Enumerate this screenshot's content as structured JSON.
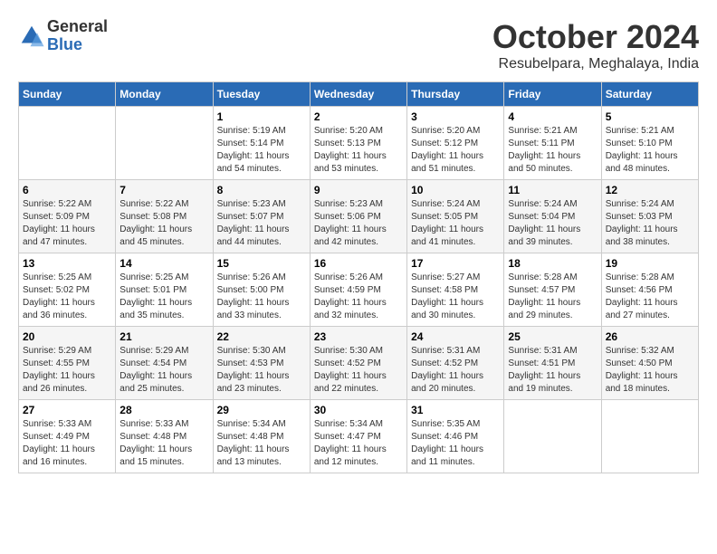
{
  "logo": {
    "general": "General",
    "blue": "Blue"
  },
  "title": "October 2024",
  "location": "Resubelpara, Meghalaya, India",
  "days_header": [
    "Sunday",
    "Monday",
    "Tuesday",
    "Wednesday",
    "Thursday",
    "Friday",
    "Saturday"
  ],
  "weeks": [
    [
      {
        "day": "",
        "info": ""
      },
      {
        "day": "",
        "info": ""
      },
      {
        "day": "1",
        "info": "Sunrise: 5:19 AM\nSunset: 5:14 PM\nDaylight: 11 hours and 54 minutes."
      },
      {
        "day": "2",
        "info": "Sunrise: 5:20 AM\nSunset: 5:13 PM\nDaylight: 11 hours and 53 minutes."
      },
      {
        "day": "3",
        "info": "Sunrise: 5:20 AM\nSunset: 5:12 PM\nDaylight: 11 hours and 51 minutes."
      },
      {
        "day": "4",
        "info": "Sunrise: 5:21 AM\nSunset: 5:11 PM\nDaylight: 11 hours and 50 minutes."
      },
      {
        "day": "5",
        "info": "Sunrise: 5:21 AM\nSunset: 5:10 PM\nDaylight: 11 hours and 48 minutes."
      }
    ],
    [
      {
        "day": "6",
        "info": "Sunrise: 5:22 AM\nSunset: 5:09 PM\nDaylight: 11 hours and 47 minutes."
      },
      {
        "day": "7",
        "info": "Sunrise: 5:22 AM\nSunset: 5:08 PM\nDaylight: 11 hours and 45 minutes."
      },
      {
        "day": "8",
        "info": "Sunrise: 5:23 AM\nSunset: 5:07 PM\nDaylight: 11 hours and 44 minutes."
      },
      {
        "day": "9",
        "info": "Sunrise: 5:23 AM\nSunset: 5:06 PM\nDaylight: 11 hours and 42 minutes."
      },
      {
        "day": "10",
        "info": "Sunrise: 5:24 AM\nSunset: 5:05 PM\nDaylight: 11 hours and 41 minutes."
      },
      {
        "day": "11",
        "info": "Sunrise: 5:24 AM\nSunset: 5:04 PM\nDaylight: 11 hours and 39 minutes."
      },
      {
        "day": "12",
        "info": "Sunrise: 5:24 AM\nSunset: 5:03 PM\nDaylight: 11 hours and 38 minutes."
      }
    ],
    [
      {
        "day": "13",
        "info": "Sunrise: 5:25 AM\nSunset: 5:02 PM\nDaylight: 11 hours and 36 minutes."
      },
      {
        "day": "14",
        "info": "Sunrise: 5:25 AM\nSunset: 5:01 PM\nDaylight: 11 hours and 35 minutes."
      },
      {
        "day": "15",
        "info": "Sunrise: 5:26 AM\nSunset: 5:00 PM\nDaylight: 11 hours and 33 minutes."
      },
      {
        "day": "16",
        "info": "Sunrise: 5:26 AM\nSunset: 4:59 PM\nDaylight: 11 hours and 32 minutes."
      },
      {
        "day": "17",
        "info": "Sunrise: 5:27 AM\nSunset: 4:58 PM\nDaylight: 11 hours and 30 minutes."
      },
      {
        "day": "18",
        "info": "Sunrise: 5:28 AM\nSunset: 4:57 PM\nDaylight: 11 hours and 29 minutes."
      },
      {
        "day": "19",
        "info": "Sunrise: 5:28 AM\nSunset: 4:56 PM\nDaylight: 11 hours and 27 minutes."
      }
    ],
    [
      {
        "day": "20",
        "info": "Sunrise: 5:29 AM\nSunset: 4:55 PM\nDaylight: 11 hours and 26 minutes."
      },
      {
        "day": "21",
        "info": "Sunrise: 5:29 AM\nSunset: 4:54 PM\nDaylight: 11 hours and 25 minutes."
      },
      {
        "day": "22",
        "info": "Sunrise: 5:30 AM\nSunset: 4:53 PM\nDaylight: 11 hours and 23 minutes."
      },
      {
        "day": "23",
        "info": "Sunrise: 5:30 AM\nSunset: 4:52 PM\nDaylight: 11 hours and 22 minutes."
      },
      {
        "day": "24",
        "info": "Sunrise: 5:31 AM\nSunset: 4:52 PM\nDaylight: 11 hours and 20 minutes."
      },
      {
        "day": "25",
        "info": "Sunrise: 5:31 AM\nSunset: 4:51 PM\nDaylight: 11 hours and 19 minutes."
      },
      {
        "day": "26",
        "info": "Sunrise: 5:32 AM\nSunset: 4:50 PM\nDaylight: 11 hours and 18 minutes."
      }
    ],
    [
      {
        "day": "27",
        "info": "Sunrise: 5:33 AM\nSunset: 4:49 PM\nDaylight: 11 hours and 16 minutes."
      },
      {
        "day": "28",
        "info": "Sunrise: 5:33 AM\nSunset: 4:48 PM\nDaylight: 11 hours and 15 minutes."
      },
      {
        "day": "29",
        "info": "Sunrise: 5:34 AM\nSunset: 4:48 PM\nDaylight: 11 hours and 13 minutes."
      },
      {
        "day": "30",
        "info": "Sunrise: 5:34 AM\nSunset: 4:47 PM\nDaylight: 11 hours and 12 minutes."
      },
      {
        "day": "31",
        "info": "Sunrise: 5:35 AM\nSunset: 4:46 PM\nDaylight: 11 hours and 11 minutes."
      },
      {
        "day": "",
        "info": ""
      },
      {
        "day": "",
        "info": ""
      }
    ]
  ]
}
